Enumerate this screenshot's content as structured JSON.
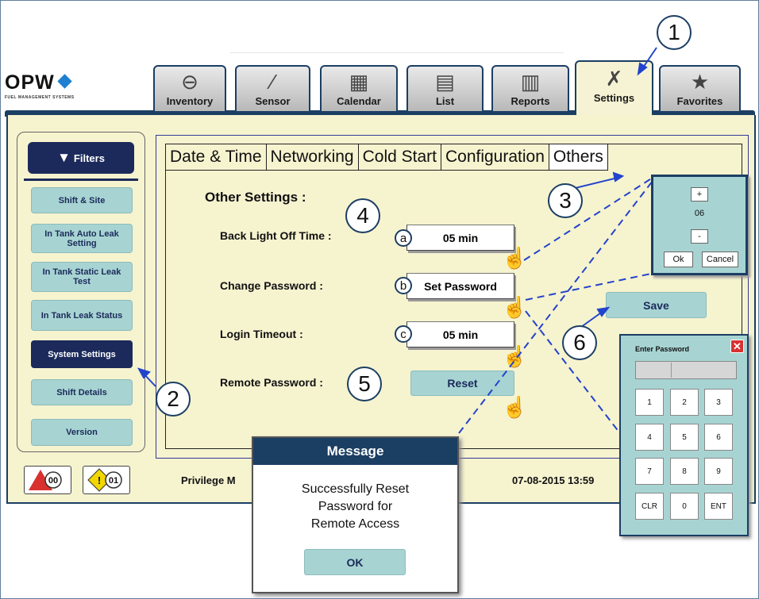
{
  "brand": {
    "name": "OPW",
    "tagline": "FUEL MANAGEMENT SYSTEMS"
  },
  "main_tabs": [
    {
      "label": "Inventory",
      "icon": "drop-icon"
    },
    {
      "label": "Sensor",
      "icon": "probe-icon"
    },
    {
      "label": "Calendar",
      "icon": "calendar-icon"
    },
    {
      "label": "List",
      "icon": "list-icon"
    },
    {
      "label": "Reports",
      "icon": "reports-icon"
    },
    {
      "label": "Settings",
      "icon": "tools-icon",
      "active": true
    },
    {
      "label": "Favorites",
      "icon": "star-icon"
    }
  ],
  "sidebar": {
    "filters_label": "Filters",
    "items": [
      {
        "label": "Shift & Site"
      },
      {
        "label": "In Tank Auto Leak Setting"
      },
      {
        "label": "In Tank Static Leak Test"
      },
      {
        "label": "In Tank Leak Status"
      },
      {
        "label": "System Settings",
        "active": true
      },
      {
        "label": "Shift Details"
      },
      {
        "label": "Version"
      }
    ]
  },
  "sub_tabs": [
    "Date & Time",
    "Networking",
    "Cold Start",
    "Configuration",
    "Others"
  ],
  "other_settings": {
    "heading": "Other Settings :",
    "backlight_label": "Back Light Off Time :",
    "backlight_value": "05 min",
    "password_label": "Change Password :",
    "password_button": "Set Password",
    "login_label": "Login Timeout :",
    "login_value": "05 min",
    "remote_label": "Remote Password :",
    "reset_button": "Reset",
    "save_button": "Save"
  },
  "markers": {
    "a": "a",
    "b": "b",
    "c": "c"
  },
  "callouts": [
    "1",
    "2",
    "3",
    "4",
    "5",
    "6"
  ],
  "stepper": {
    "plus": "+",
    "value": "06",
    "minus": "-",
    "ok": "Ok",
    "cancel": "Cancel"
  },
  "keypad": {
    "title": "Enter Password",
    "close": "✕",
    "keys": [
      "1",
      "2",
      "3",
      "4",
      "5",
      "6",
      "7",
      "8",
      "9",
      "CLR",
      "0",
      "ENT"
    ]
  },
  "status_bar": {
    "alarm_count": "00",
    "warning_count": "01",
    "privilege": "Privilege M",
    "datetime": "07-08-2015 13:59"
  },
  "message": {
    "title": "Message",
    "lines": [
      "Successfully Reset",
      "Password for",
      "Remote Access"
    ],
    "ok": "OK"
  },
  "colors": {
    "navy": "#1b3e63",
    "teal": "#a7d4d2",
    "panel": "#f6f3cf",
    "alert_red": "#d93030",
    "warn_yellow": "#f2d600"
  }
}
